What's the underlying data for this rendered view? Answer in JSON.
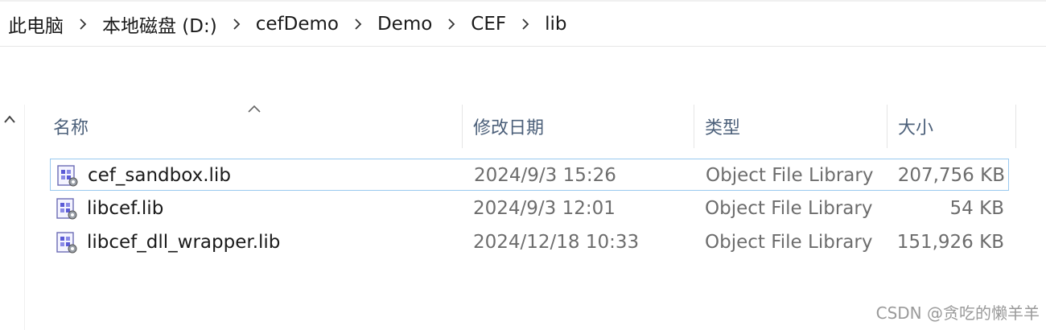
{
  "breadcrumb": {
    "items": [
      "此电脑",
      "本地磁盘 (D:)",
      "cefDemo",
      "Demo",
      "CEF",
      "lib"
    ]
  },
  "columns": {
    "name": "名称",
    "modified": "修改日期",
    "type": "类型",
    "size": "大小"
  },
  "files": [
    {
      "name": "cef_sandbox.lib",
      "modified": "2024/9/3 15:26",
      "type": "Object File Library",
      "size": "207,756 KB",
      "selected": true
    },
    {
      "name": "libcef.lib",
      "modified": "2024/9/3 12:01",
      "type": "Object File Library",
      "size": "54 KB",
      "selected": false
    },
    {
      "name": "libcef_dll_wrapper.lib",
      "modified": "2024/12/18 10:33",
      "type": "Object File Library",
      "size": "151,926 KB",
      "selected": false
    }
  ],
  "icons": {
    "breadcrumb_separator": "chevron-right-icon",
    "sort_indicator": "chevron-up-icon",
    "nav_up": "chevron-up-icon",
    "file": "library-file-icon"
  },
  "colors": {
    "selection_border": "#99c9ef",
    "header_text": "#4c607a"
  },
  "watermark": "CSDN @贪吃的懒羊羊"
}
